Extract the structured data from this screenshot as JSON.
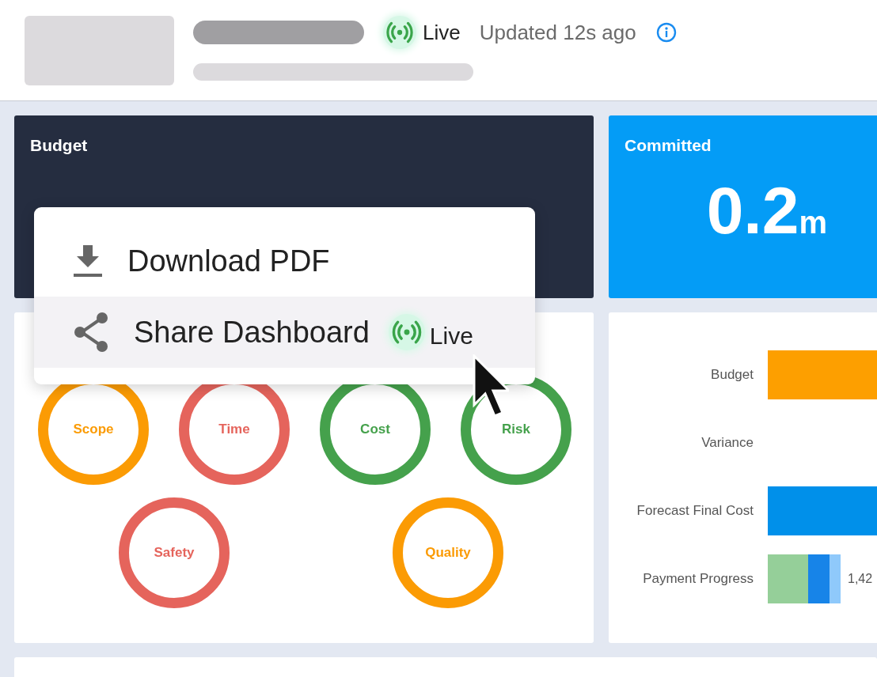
{
  "header": {
    "live_label": "Live",
    "updated": "Updated 12s ago"
  },
  "kpi_cards": [
    {
      "title": "Budget",
      "kind": "dark"
    },
    {
      "title": "Committed",
      "kind": "blue",
      "value": "0.2",
      "unit": "m"
    }
  ],
  "health_rings": [
    {
      "label": "Scope",
      "color": "#fb9b04"
    },
    {
      "label": "Time",
      "color": "#e5645c"
    },
    {
      "label": "Cost",
      "color": "#45a14c"
    },
    {
      "label": "Risk",
      "color": "#45a14c"
    },
    {
      "label": "Safety",
      "color": "#e5645c"
    },
    {
      "label": "Quality",
      "color": "#fb9b04"
    }
  ],
  "cost_chart": [
    {
      "label": "Budget",
      "segments": [
        {
          "color": "#fd9f00"
        }
      ]
    },
    {
      "label": "Variance"
    },
    {
      "label": "Forecast Final Cost",
      "segments": [
        {
          "color": "#0090ea"
        }
      ]
    },
    {
      "label": "Payment Progress",
      "segments": [
        {
          "color": "#95cf99"
        },
        {
          "color": "#1784e8"
        },
        {
          "color": "#8fc9fb"
        }
      ],
      "value": "1,42"
    }
  ],
  "menu": [
    {
      "kind": "download",
      "label": "Download PDF",
      "selected": false
    },
    {
      "kind": "share",
      "label": "Share Dashboard",
      "selected": true,
      "badge": "Live"
    }
  ]
}
